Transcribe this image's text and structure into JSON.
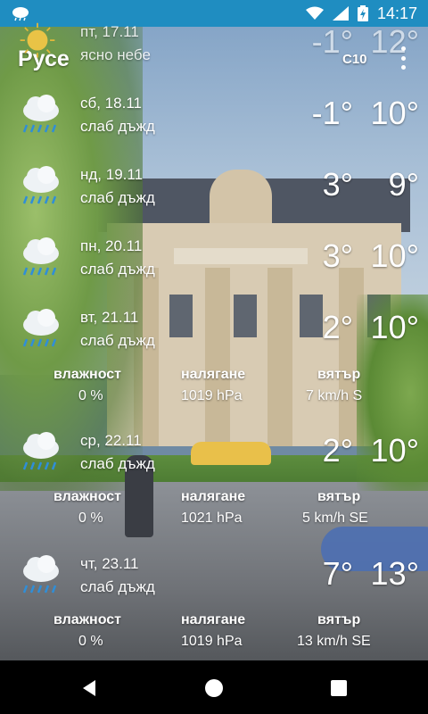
{
  "status_bar": {
    "time": "14:17",
    "left_icon": "weather-notification-icon",
    "icons": [
      "wifi-icon",
      "signal-icon",
      "battery-charging-icon"
    ]
  },
  "header": {
    "city": "Русе",
    "station_code": "C10"
  },
  "days": [
    {
      "date": "пт, 17.11",
      "description": "ясно небе",
      "min": "-1°",
      "max": "12°",
      "icon": "sun-icon"
    },
    {
      "date": "сб, 18.11",
      "description": "слаб дъжд",
      "min": "-1°",
      "max": "10°",
      "icon": "rain-cloud-icon"
    },
    {
      "date": "нд, 19.11",
      "description": "слаб дъжд",
      "min": "3°",
      "max": "9°",
      "icon": "rain-cloud-icon"
    },
    {
      "date": "пн, 20.11",
      "description": "слаб дъжд",
      "min": "3°",
      "max": "10°",
      "icon": "rain-cloud-icon"
    },
    {
      "date": "вт, 21.11",
      "description": "слаб дъжд",
      "min": "2°",
      "max": "10°",
      "icon": "rain-cloud-icon",
      "details": {
        "humidity_label": "влажност",
        "humidity": "0 %",
        "pressure_label": "налягане",
        "pressure": "1019 hPa",
        "wind_label": "вятър",
        "wind": "7 km/h S"
      }
    },
    {
      "date": "ср, 22.11",
      "description": "слаб дъжд",
      "min": "2°",
      "max": "10°",
      "icon": "rain-cloud-icon",
      "details": {
        "humidity_label": "влажност",
        "humidity": "0 %",
        "pressure_label": "налягане",
        "pressure": "1021 hPa",
        "wind_label": "вятър",
        "wind": "5 km/h SE"
      }
    },
    {
      "date": "чт, 23.11",
      "description": "слаб дъжд",
      "min": "7°",
      "max": "13°",
      "icon": "rain-cloud-icon",
      "details": {
        "humidity_label": "влажност",
        "humidity": "0 %",
        "pressure_label": "налягане",
        "pressure": "1019 hPa",
        "wind_label": "вятър",
        "wind": "13 km/h SE"
      }
    }
  ],
  "colors": {
    "status_bar": "#1f8dc1",
    "nav_bar": "#000000",
    "text": "#ffffff",
    "rain": "#2f8ed8"
  }
}
